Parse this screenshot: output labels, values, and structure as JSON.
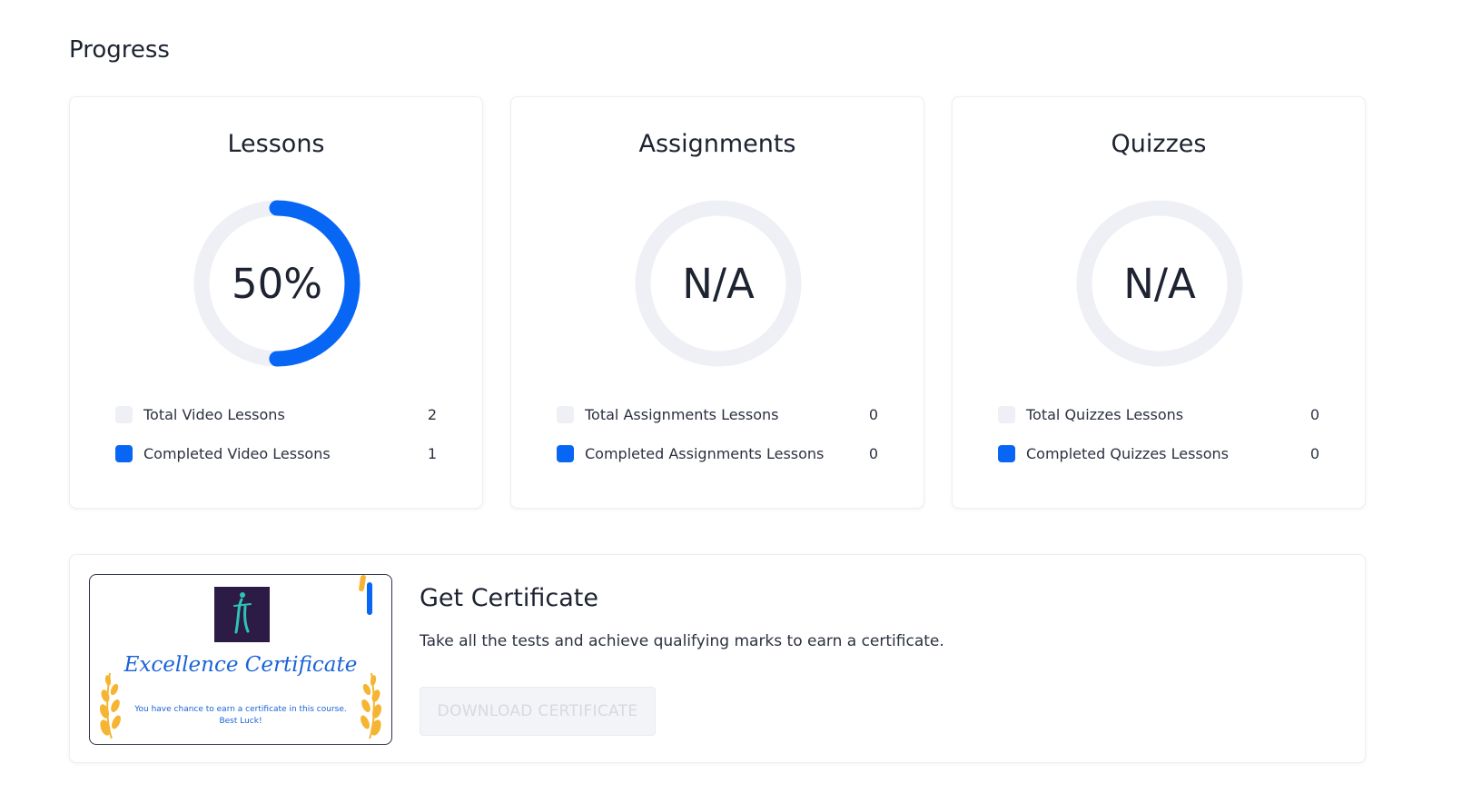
{
  "page": {
    "title": "Progress"
  },
  "colors": {
    "accent": "#0866f5",
    "track": "#eef0f5",
    "text": "#1d2330",
    "certificate_blue": "#1a63d8",
    "laurel": "#f5b533",
    "logo_bg": "#2b1b45"
  },
  "cards": [
    {
      "title": "Lessons",
      "center_label": "50%",
      "progress_fraction": 0.5,
      "total_label": "Total Video Lessons",
      "total_value": "2",
      "completed_label": "Completed Video Lessons",
      "completed_value": "1"
    },
    {
      "title": "Assignments",
      "center_label": "N/A",
      "progress_fraction": 0,
      "total_label": "Total Assignments Lessons",
      "total_value": "0",
      "completed_label": "Completed Assignments Lessons",
      "completed_value": "0"
    },
    {
      "title": "Quizzes",
      "center_label": "N/A",
      "progress_fraction": 0,
      "total_label": "Total Quizzes Lessons",
      "total_value": "0",
      "completed_label": "Completed Quizzes Lessons",
      "completed_value": "0"
    }
  ],
  "certificate": {
    "image_heading": "Excellence Certificate",
    "image_note": "You have chance to earn a certificate in this course. Best Luck!",
    "title": "Get Certificate",
    "description": "Take all the tests and achieve qualifying marks to earn a certificate.",
    "button_label": "DOWNLOAD CERTIFICATE",
    "button_disabled": true
  },
  "icons": {
    "logo": "ti-logo-icon",
    "laurel": "laurel-branch-icon",
    "legend_total": "total-swatch-icon",
    "legend_completed": "completed-swatch-icon"
  }
}
